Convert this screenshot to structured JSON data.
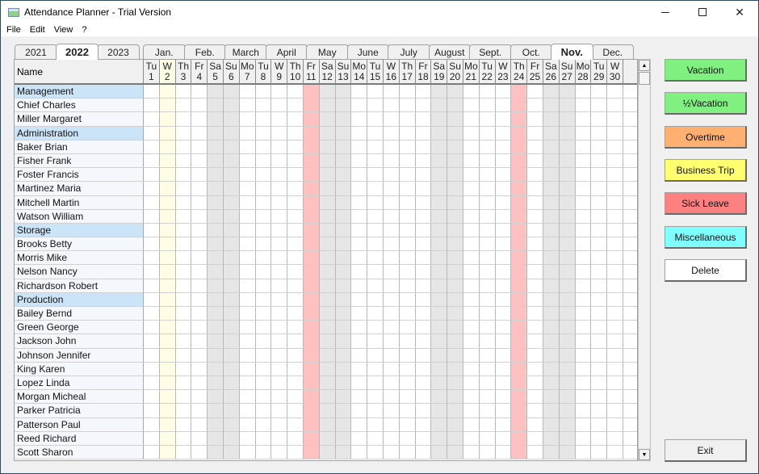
{
  "window": {
    "title": "Attendance Planner - Trial Version",
    "controls": [
      "minimize",
      "maximize",
      "close"
    ]
  },
  "menu": [
    "File",
    "Edit",
    "View",
    "?"
  ],
  "year_tabs": [
    {
      "label": "2021",
      "active": false
    },
    {
      "label": "2022",
      "active": true
    },
    {
      "label": "2023",
      "active": false
    }
  ],
  "month_tabs": [
    {
      "label": "Jan.",
      "active": false
    },
    {
      "label": "Feb.",
      "active": false
    },
    {
      "label": "March",
      "active": false
    },
    {
      "label": "April",
      "active": false
    },
    {
      "label": "May",
      "active": false
    },
    {
      "label": "June",
      "active": false
    },
    {
      "label": "July",
      "active": false
    },
    {
      "label": "August",
      "active": false
    },
    {
      "label": "Sept.",
      "active": false
    },
    {
      "label": "Oct.",
      "active": false
    },
    {
      "label": "Nov.",
      "active": true
    },
    {
      "label": "Dec.",
      "active": false
    }
  ],
  "grid": {
    "name_header": "Name",
    "days": [
      {
        "wd": "Tu",
        "d": "1",
        "type": "normal"
      },
      {
        "wd": "W",
        "d": "2",
        "type": "today"
      },
      {
        "wd": "Th",
        "d": "3",
        "type": "normal"
      },
      {
        "wd": "Fr",
        "d": "4",
        "type": "normal"
      },
      {
        "wd": "Sa",
        "d": "5",
        "type": "weekend"
      },
      {
        "wd": "Su",
        "d": "6",
        "type": "weekend"
      },
      {
        "wd": "Mo",
        "d": "7",
        "type": "normal"
      },
      {
        "wd": "Tu",
        "d": "8",
        "type": "normal"
      },
      {
        "wd": "W",
        "d": "9",
        "type": "normal"
      },
      {
        "wd": "Th",
        "d": "10",
        "type": "normal"
      },
      {
        "wd": "Fr",
        "d": "11",
        "type": "holiday"
      },
      {
        "wd": "Sa",
        "d": "12",
        "type": "weekend"
      },
      {
        "wd": "Su",
        "d": "13",
        "type": "weekend"
      },
      {
        "wd": "Mo",
        "d": "14",
        "type": "normal"
      },
      {
        "wd": "Tu",
        "d": "15",
        "type": "normal"
      },
      {
        "wd": "W",
        "d": "16",
        "type": "normal"
      },
      {
        "wd": "Th",
        "d": "17",
        "type": "normal"
      },
      {
        "wd": "Fr",
        "d": "18",
        "type": "normal"
      },
      {
        "wd": "Sa",
        "d": "19",
        "type": "weekend"
      },
      {
        "wd": "Su",
        "d": "20",
        "type": "weekend"
      },
      {
        "wd": "Mo",
        "d": "21",
        "type": "normal"
      },
      {
        "wd": "Tu",
        "d": "22",
        "type": "normal"
      },
      {
        "wd": "W",
        "d": "23",
        "type": "normal"
      },
      {
        "wd": "Th",
        "d": "24",
        "type": "holiday"
      },
      {
        "wd": "Fr",
        "d": "25",
        "type": "normal"
      },
      {
        "wd": "Sa",
        "d": "26",
        "type": "weekend"
      },
      {
        "wd": "Su",
        "d": "27",
        "type": "weekend"
      },
      {
        "wd": "Mo",
        "d": "28",
        "type": "normal"
      },
      {
        "wd": "Tu",
        "d": "29",
        "type": "normal"
      },
      {
        "wd": "W",
        "d": "30",
        "type": "normal"
      }
    ],
    "rows": [
      {
        "name": "Management",
        "group": true
      },
      {
        "name": "Chief Charles",
        "group": false
      },
      {
        "name": "Miller Margaret",
        "group": false
      },
      {
        "name": "Administration",
        "group": true
      },
      {
        "name": "Baker Brian",
        "group": false
      },
      {
        "name": "Fisher Frank",
        "group": false
      },
      {
        "name": "Foster Francis",
        "group": false
      },
      {
        "name": "Martinez Maria",
        "group": false
      },
      {
        "name": "Mitchell Martin",
        "group": false
      },
      {
        "name": "Watson William",
        "group": false
      },
      {
        "name": "Storage",
        "group": true
      },
      {
        "name": "Brooks Betty",
        "group": false
      },
      {
        "name": "Morris Mike",
        "group": false
      },
      {
        "name": "Nelson Nancy",
        "group": false
      },
      {
        "name": "Richardson Robert",
        "group": false
      },
      {
        "name": "Production",
        "group": true
      },
      {
        "name": "Bailey Bernd",
        "group": false
      },
      {
        "name": "Green George",
        "group": false
      },
      {
        "name": "Jackson John",
        "group": false
      },
      {
        "name": "Johnson Jennifer",
        "group": false
      },
      {
        "name": "King Karen",
        "group": false
      },
      {
        "name": "Lopez Linda",
        "group": false
      },
      {
        "name": "Morgan Micheal",
        "group": false
      },
      {
        "name": "Parker Patricia",
        "group": false
      },
      {
        "name": "Patterson Paul",
        "group": false
      },
      {
        "name": "Reed Richard",
        "group": false
      },
      {
        "name": "Scott Sharon",
        "group": false
      }
    ]
  },
  "buttons": {
    "vacation": "Vacation",
    "half_vacation": "½Vacation",
    "overtime": "Overtime",
    "business_trip": "Business Trip",
    "sick_leave": "Sick Leave",
    "miscellaneous": "Miscellaneous",
    "delete": "Delete",
    "exit": "Exit"
  },
  "colors": {
    "vacation": "#80f080",
    "overtime": "#ffb070",
    "business_trip": "#ffff70",
    "sick_leave": "#ff8080",
    "miscellaneous": "#80ffff",
    "delete": "#ffffff",
    "group_row": "#cce4f7",
    "weekend": "#e6e6e6",
    "holiday": "#ffc0c0",
    "today": "#fffce6"
  },
  "scrollbar": {
    "up": "▲",
    "down": "▼"
  }
}
